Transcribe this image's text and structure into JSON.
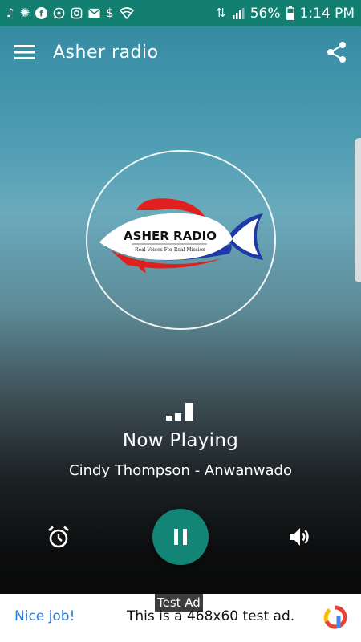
{
  "status_bar": {
    "battery_percent": "56%",
    "time": "1:14 PM",
    "left_icons": [
      "music-note-icon",
      "settings-app-icon",
      "facebook-icon",
      "whatsapp-icon",
      "instagram-icon",
      "mail-icon",
      "dollar-icon",
      "wifi-icon"
    ],
    "right_icons": [
      "data-transfer-icon",
      "signal-icon",
      "battery-icon"
    ]
  },
  "app_bar": {
    "title": "Asher radio",
    "menu_icon": "hamburger-menu-icon",
    "share_icon": "share-icon"
  },
  "logo": {
    "name": "ASHER RADIO",
    "tagline": "Real Voices For Real Mission"
  },
  "player": {
    "status_title": "Now Playing",
    "track": "Cindy Thompson - Anwanwado",
    "play_button_state": "pause",
    "accent": "#128576"
  },
  "controls": {
    "alarm_icon": "alarm-clock-icon",
    "volume_icon": "volume-icon"
  },
  "ad": {
    "label": "Test Ad",
    "cta": "Nice job!",
    "text": "This is a 468x60 test ad."
  },
  "colors": {
    "status_bar": "#127f70",
    "play_button": "#128576",
    "ad_cta": "#2a7ad8"
  }
}
